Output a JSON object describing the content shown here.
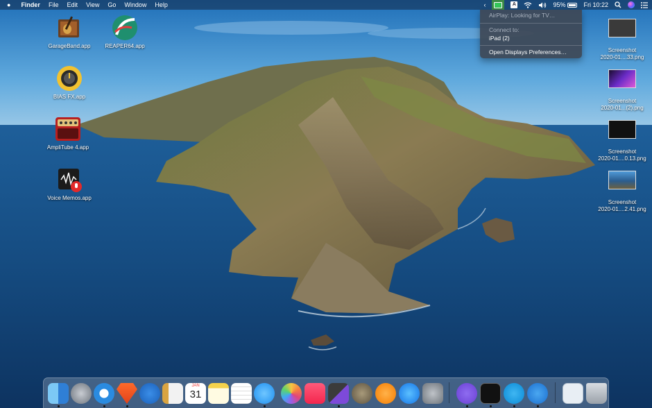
{
  "menubar": {
    "app_name": "Finder",
    "menus": [
      "File",
      "Edit",
      "View",
      "Go",
      "Window",
      "Help"
    ],
    "input_source": "A",
    "battery_percent": "95%",
    "clock": "Fri 10:22"
  },
  "airplay_menu": {
    "status": "AirPlay: Looking for TV…",
    "connect_heading": "Connect to:",
    "device": "iPad (2)",
    "prefs_item": "Open Displays Preferences…"
  },
  "desktop_icons": [
    {
      "label": "GarageBand.app",
      "icon": "garageband-icon"
    },
    {
      "label": "REAPER64.app",
      "icon": "reaper-icon"
    },
    {
      "label": "BIAS FX.app",
      "icon": "bias-fx-icon"
    },
    {
      "label": "AmpliTube 4.app",
      "icon": "amplitube-icon"
    },
    {
      "label": "Voice Memos.app",
      "icon": "voice-memos-icon"
    }
  ],
  "desktop_files": [
    {
      "label1": "Screenshot",
      "label2": "2020-01....33.png"
    },
    {
      "label1": "Screenshot",
      "label2": "2020-01...(2).png"
    },
    {
      "label1": "Screenshot",
      "label2": "2020-01....0.13.png"
    },
    {
      "label1": "Screenshot",
      "label2": "2020-01....2.41.png"
    }
  ],
  "dock": {
    "apps": [
      "finder",
      "launchpad",
      "safari",
      "brave",
      "direct-mail",
      "notefile",
      "calendar",
      "notes",
      "reminders",
      "messages",
      "photos",
      "music",
      "final-cut-pro",
      "gimp",
      "books",
      "app-store",
      "system-preferences",
      "viber",
      "activity-monitor",
      "skype",
      "airmail",
      "downloads",
      "trash"
    ],
    "calendar_month": "JAN",
    "calendar_day": "31"
  },
  "colors": {
    "sky": "#2f8fd6",
    "sea": "#15406e",
    "airplay_active": "#3c8a46"
  }
}
